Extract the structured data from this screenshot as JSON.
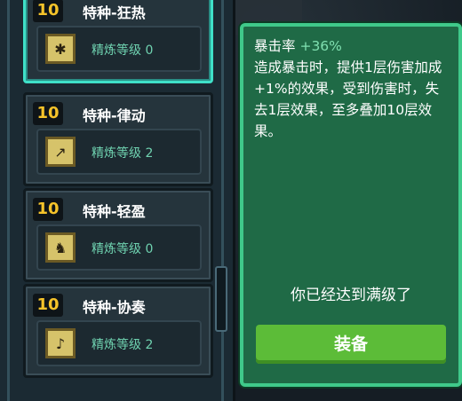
{
  "items": [
    {
      "level": "10",
      "name": "特种-狂热",
      "refine": "精炼等级 0",
      "icon": "chip-icon"
    },
    {
      "level": "10",
      "name": "特种-律动",
      "refine": "精炼等级 2",
      "icon": "chip-icon"
    },
    {
      "level": "10",
      "name": "特种-轻盈",
      "refine": "精炼等级 0",
      "icon": "chip-icon"
    },
    {
      "level": "10",
      "name": "特种-协奏",
      "refine": "精炼等级 2",
      "icon": "chip-icon"
    }
  ],
  "tooltip": {
    "stat_label": "暴击率",
    "stat_value": "+36%",
    "description": "造成暴击时，提供1层伤害加成+1%的效果，受到伤害时，失去1层效果，至多叠加10层效果。",
    "max_level_text": "你已经达到满级了",
    "equip_label": "装备"
  },
  "colors": {
    "selected_border": "#3fe0c8",
    "level_text": "#f5c32a",
    "refine_text": "#6fd2b0",
    "tooltip_bg": "#1f6a46",
    "equip_button": "#5cbc38"
  }
}
